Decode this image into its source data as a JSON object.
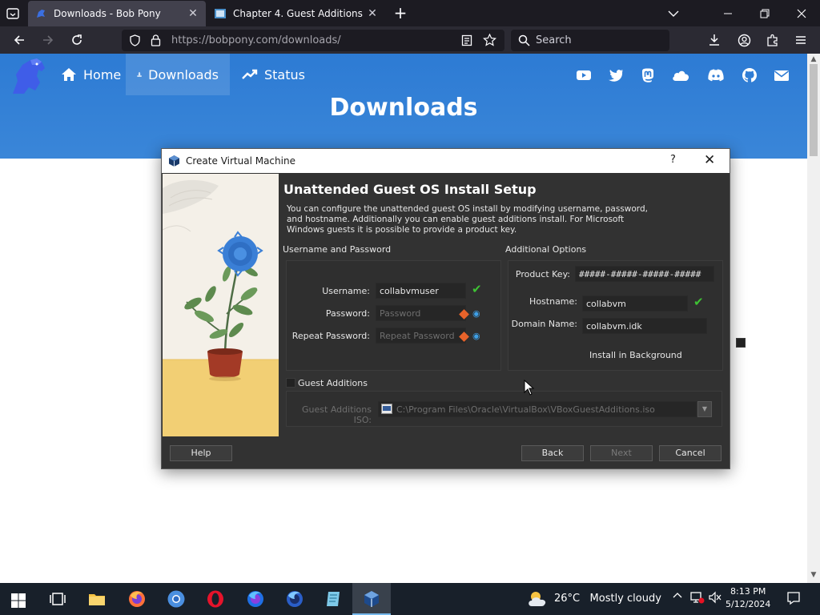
{
  "browser": {
    "tabs": [
      {
        "title": "Downloads - Bob Pony",
        "active": true
      },
      {
        "title": "Chapter 4. Guest Additions",
        "active": false
      }
    ],
    "url_host": "https://bobpony.com",
    "url_path": "/downloads/",
    "search_placeholder": "Search"
  },
  "site": {
    "nav": [
      {
        "label": "Home"
      },
      {
        "label": "Downloads"
      },
      {
        "label": "Status"
      }
    ],
    "social_icons": [
      "youtube-icon",
      "twitter-icon",
      "mastodon-icon",
      "cloud-icon",
      "discord-icon",
      "github-icon",
      "email-icon"
    ],
    "heading": "Downloads",
    "banner_color": "#2d7bd4"
  },
  "dialog": {
    "title": "Create Virtual Machine",
    "help_glyph": "?",
    "heading": "Unattended Guest OS Install Setup",
    "description": "You can configure the unattended guest OS install by modifying username, password, and hostname. Additionally you can enable guest additions install. For Microsoft Windows guests it is possible to provide a product key.",
    "user_group": {
      "label": "Username and Password",
      "username_label": "Username:",
      "username_value": "collabvmuser",
      "password_label": "Password:",
      "password_placeholder": "Password",
      "repeat_label": "Repeat Password:",
      "repeat_placeholder": "Repeat Password"
    },
    "options_group": {
      "label": "Additional Options",
      "product_key_label": "Product Key:",
      "product_key_value": "#####-#####-#####-#####",
      "hostname_label": "Hostname:",
      "hostname_value": "collabvm",
      "domain_label": "Domain Name:",
      "domain_value": "collabvm.idk",
      "install_bg_label": "Install in Background"
    },
    "guest_additions": {
      "label": "Guest Additions",
      "iso_label": "Guest Additions ISO:",
      "iso_value": "C:\\Program Files\\Oracle\\VirtualBox\\VBoxGuestAdditions.iso"
    },
    "buttons": {
      "help": "Help",
      "back": "Back",
      "next": "Next",
      "cancel": "Cancel"
    }
  },
  "taskbar": {
    "weather_temp": "26°C",
    "weather_text": "Mostly cloudy",
    "time": "8:13 PM",
    "date": "5/12/2024",
    "accent": "#76b9ed"
  }
}
